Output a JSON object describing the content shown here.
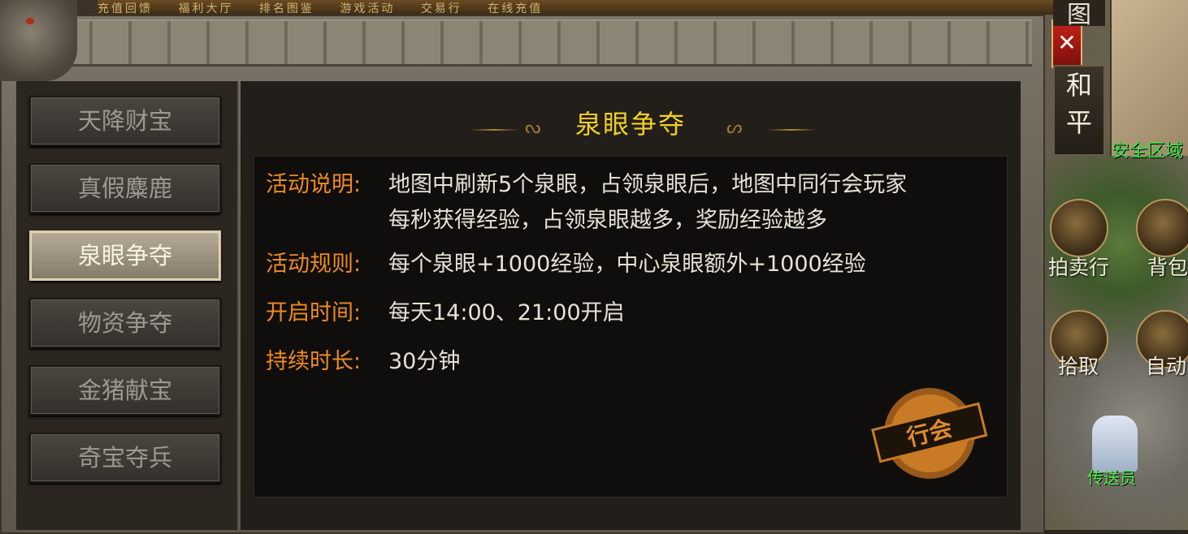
{
  "top_bar": {
    "items": [
      "充值回馈",
      "福利大厅",
      "排名图鉴",
      "游戏活动",
      "交易行",
      "在线充值"
    ]
  },
  "window": {
    "close_label": "✕"
  },
  "sidebar": {
    "items": [
      {
        "label": "天降财宝",
        "active": false
      },
      {
        "label": "真假麋鹿",
        "active": false
      },
      {
        "label": "泉眼争夺",
        "active": true
      },
      {
        "label": "物资争夺",
        "active": false
      },
      {
        "label": "金猪献宝",
        "active": false
      },
      {
        "label": "奇宝夺兵",
        "active": false
      }
    ]
  },
  "panel": {
    "title": "泉眼争夺",
    "rows": [
      {
        "label": "活动说明:",
        "line1": "地图中刷新5个泉眼，占领泉眼后，地图中同行会玩家",
        "line2": "每秒获得经验，占领泉眼越多，奖励经验越多"
      },
      {
        "label": "活动规则:",
        "line1": "每个泉眼+1000经验，中心泉眼额外+1000经验"
      },
      {
        "label": "开启时间:",
        "line1": "每天14:00、21:00开启"
      },
      {
        "label": "持续时长:",
        "line1": "30分钟"
      }
    ],
    "stamp_text": "行会"
  },
  "hud": {
    "top_char": "图",
    "mode_chars": [
      "和",
      "平"
    ],
    "safe_zone": "安全区域",
    "buttons": {
      "auction": "拍卖行",
      "bag": "背包",
      "pickup": "拾取",
      "auto": "自动"
    },
    "npc_name": "传送员"
  },
  "colors": {
    "title": "#f2d023",
    "label": "#f08a1f",
    "text": "#e7e2d6",
    "close": "#c2231b",
    "safe": "#3be04a"
  }
}
